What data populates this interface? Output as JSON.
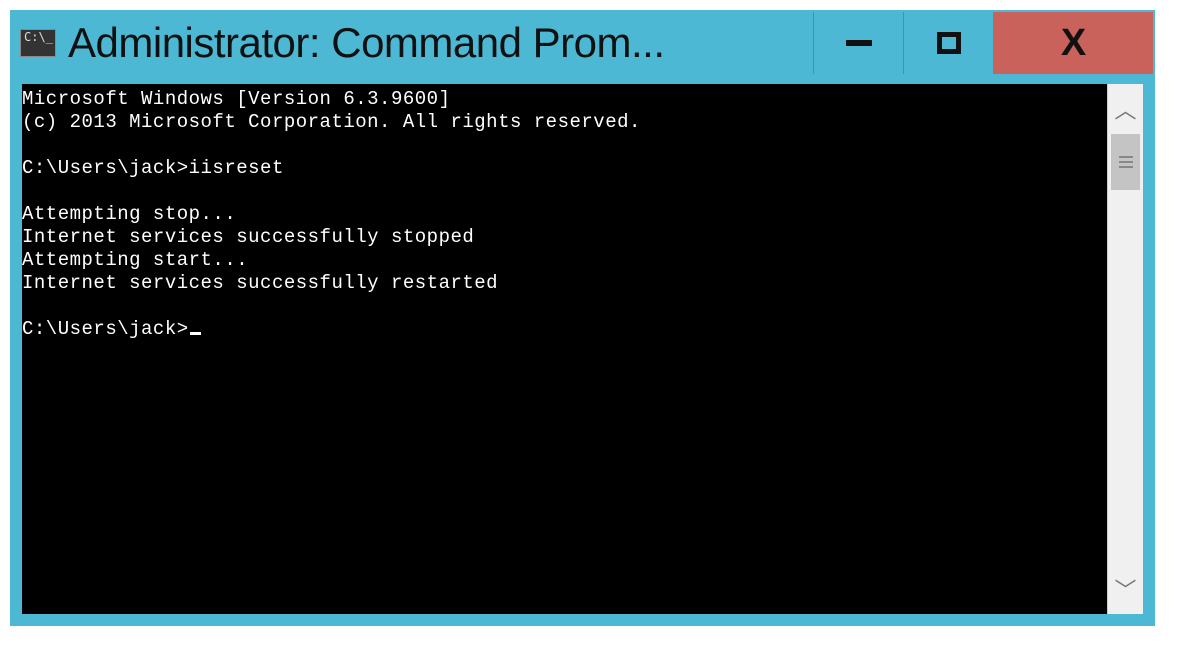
{
  "window": {
    "title_icon_text": "C:\\_",
    "title": "Administrator: Command Prom..."
  },
  "console": {
    "lines": [
      "Microsoft Windows [Version 6.3.9600]",
      "(c) 2013 Microsoft Corporation. All rights reserved.",
      "",
      "C:\\Users\\jack>iisreset",
      "",
      "Attempting stop...",
      "Internet services successfully stopped",
      "Attempting start...",
      "Internet services successfully restarted",
      "",
      "C:\\Users\\jack>"
    ],
    "cursor_on_last_line": true
  }
}
